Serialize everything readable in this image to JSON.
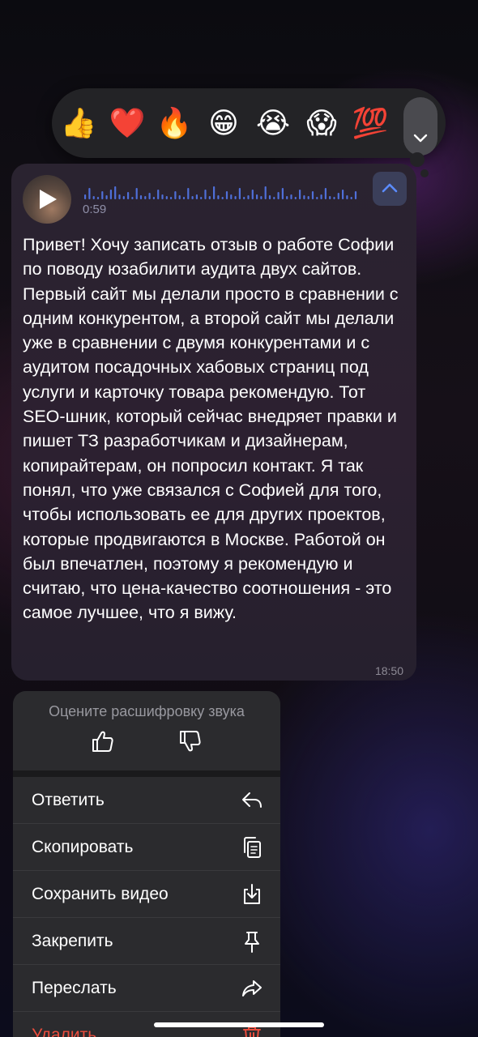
{
  "reactions": {
    "items": [
      {
        "emoji": "👍",
        "name": "thumbs-up"
      },
      {
        "emoji": "❤️",
        "name": "red-heart"
      },
      {
        "emoji": "🔥",
        "name": "fire"
      },
      {
        "emoji": "😁",
        "name": "grinning-face"
      },
      {
        "emoji": "😭",
        "name": "crying-face"
      },
      {
        "emoji": "😱",
        "name": "screaming-face"
      },
      {
        "emoji": "💯",
        "name": "hundred-points"
      }
    ],
    "expand_icon": "chevron-down-icon"
  },
  "message": {
    "duration": "0:59",
    "collapse_icon": "chevron-up-icon",
    "transcript": "Привет! Хочу записать отзыв о работе Софии по поводу юзабилити аудита двух сайтов. Первый сайт мы делали просто в сравнении с одним конкурентом, а второй сайт мы делали уже в сравнении с двумя конкурентами и с аудитом посадочных хабовых страниц под услуги и карточку товара рекомендую. Тот SEO-шник, который сейчас внедряет правки и пишет ТЗ разработчикам и дизайнерам, копирайтерам, он попросил контакт. Я так понял, что уже связался с Софией для того, чтобы использовать ее для других проектов, которые продвигаются в Москве. Работой он был впечатлен, поэтому я рекомендую и считаю, что цена-качество соотношения - это самое лучшее, что я вижу.",
    "time": "18:50"
  },
  "menu": {
    "rate_title": "Оцените расшифровку звука",
    "items": [
      {
        "label": "Ответить",
        "icon": "reply-icon"
      },
      {
        "label": "Скопировать",
        "icon": "copy-icon"
      },
      {
        "label": "Сохранить видео",
        "icon": "download-icon"
      },
      {
        "label": "Закрепить",
        "icon": "pin-icon"
      },
      {
        "label": "Переслать",
        "icon": "forward-icon"
      },
      {
        "label": "Удалить",
        "icon": "trash-icon"
      }
    ]
  },
  "colors": {
    "accent": "#5b8cff",
    "danger": "#eb4d3d",
    "waveform": "#4f6fd8"
  }
}
